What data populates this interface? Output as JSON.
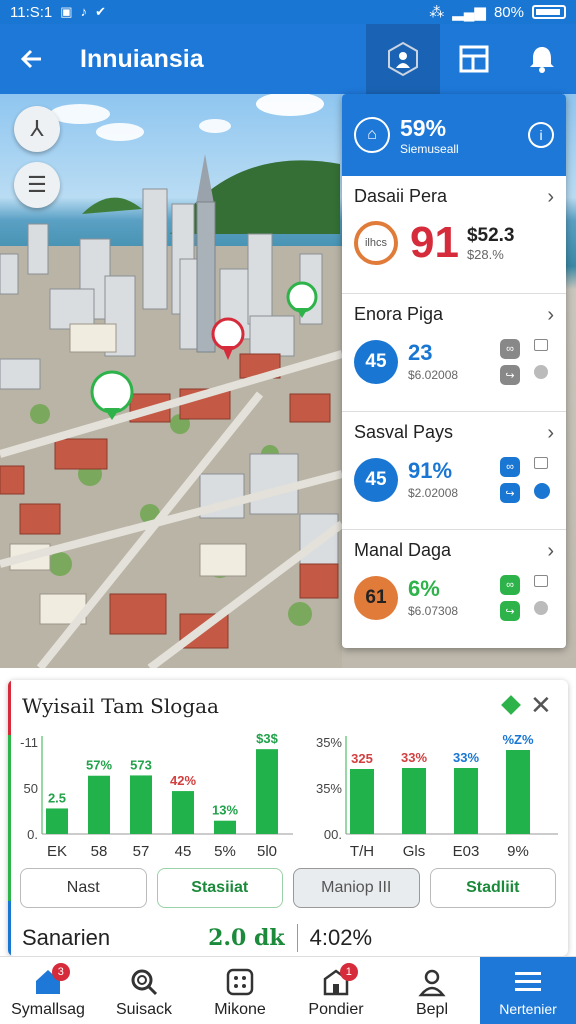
{
  "status": {
    "time": "11:S:1",
    "battery": "80%"
  },
  "appbar": {
    "title": "Innuiansia"
  },
  "panel": {
    "header": {
      "pct": "59%",
      "sub": "Siemuseall"
    },
    "items": [
      {
        "title": "Dasaii Pera",
        "circle": "ilhcs",
        "big": "91",
        "a": "$52.3",
        "b": "$28.%"
      },
      {
        "title": "Enora Piga",
        "circle": "45",
        "mid": "23",
        "sub": "$6.02008"
      },
      {
        "title": "Sasval Pays",
        "circle": "45",
        "mid": "91%",
        "sub": "$2.02008"
      },
      {
        "title": "Manal Daga",
        "circle": "61",
        "mid": "6%",
        "sub": "$6.07308"
      }
    ]
  },
  "card": {
    "title": "Wyisail Tam Slogaa",
    "buttons": [
      "Nast",
      "Stasiiat",
      "Maniop III",
      "Stadliit"
    ],
    "summary": {
      "label": "Sanarien",
      "value": "2.0 dk",
      "pct": "4:02%"
    }
  },
  "chart_data": [
    {
      "type": "bar",
      "categories": [
        "EK",
        "58",
        "57",
        "45",
        "5%",
        "5l0"
      ],
      "values": [
        2.5,
        5.7,
        5.73,
        4.2,
        1.3,
        8.3
      ],
      "data_labels": [
        "2.5",
        "57%",
        "573",
        "42%",
        "13%",
        "$3$"
      ],
      "yticks": [
        "-11",
        "50",
        "0."
      ],
      "colors": {
        "bar": "#22b24c",
        "label_green": "#22a24a",
        "label_red": "#d33f3f"
      }
    },
    {
      "type": "bar",
      "categories": [
        "T/H",
        "Gls",
        "E03",
        "9%"
      ],
      "values": [
        3.25,
        3.3,
        3.3,
        4.2
      ],
      "data_labels": [
        "325",
        "33%",
        "33%",
        "%Z%"
      ],
      "yticks": [
        "35%",
        "35%",
        "00."
      ],
      "colors": {
        "bar": "#22b24c",
        "label_red": "#d33f3f",
        "label_blue": "#1976d2"
      }
    }
  ],
  "nav": [
    {
      "label": "Symallsag",
      "badge": "3"
    },
    {
      "label": "Suisack"
    },
    {
      "label": "Mikone"
    },
    {
      "label": "Pondier",
      "badge": "1"
    },
    {
      "label": "Bepl"
    },
    {
      "label": "Nertenier"
    }
  ]
}
